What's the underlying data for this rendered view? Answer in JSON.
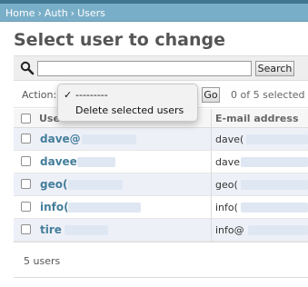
{
  "breadcrumbs": [
    {
      "label": "Home"
    },
    {
      "label": "Auth"
    },
    {
      "label": "Users"
    }
  ],
  "breadcrumb_separator": "›",
  "page_title": "Select user to change",
  "search": {
    "value": "",
    "button_label": "Search"
  },
  "actions": {
    "label": "Action:",
    "options": [
      {
        "label": "---------",
        "selected": true
      },
      {
        "label": "Delete selected users",
        "selected": false
      }
    ],
    "checkmark": "✓",
    "go_label": "Go",
    "selection_counter": "0 of 5 selected"
  },
  "table": {
    "columns": [
      "Username",
      "E-mail address"
    ],
    "rows": [
      {
        "username": "dave@",
        "email": "dave("
      },
      {
        "username": "davee",
        "email": "dave"
      },
      {
        "username": "geo(",
        "email": "geo("
      },
      {
        "username": "info(",
        "email": "info("
      },
      {
        "username": "tire",
        "email": "info@"
      }
    ]
  },
  "footer": {
    "count_text": "5 users"
  },
  "colors": {
    "header_bar": "#417690",
    "breadcrumb_bg": "#79aec8",
    "link": "#447e9b",
    "row_alt": "#eef0f8"
  }
}
